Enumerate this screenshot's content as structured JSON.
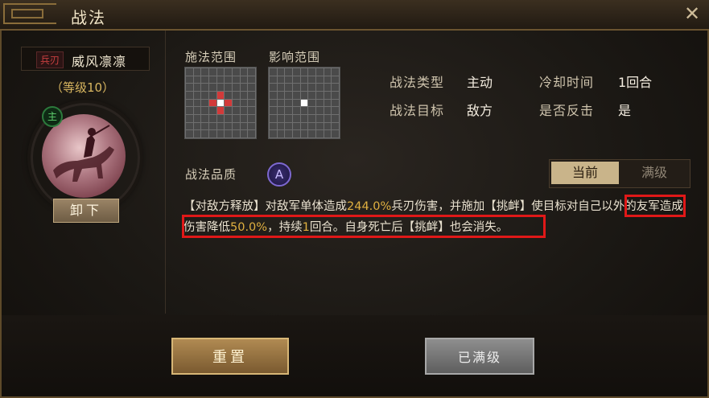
{
  "window": {
    "title": "战法",
    "close_icon": "close-icon"
  },
  "skill": {
    "type_tag": "兵刃",
    "name": "威风凛凛",
    "level": "（等级10）",
    "commander_badge": "主",
    "unequip_label": "卸下"
  },
  "ranges": {
    "cast_label": "施法范围",
    "effect_label": "影响范围"
  },
  "info": {
    "type_label": "战法类型",
    "type_value": "主动",
    "cooldown_label": "冷却时间",
    "cooldown_value": "1回合",
    "target_label": "战法目标",
    "target_value": "敌方",
    "counter_label": "是否反击",
    "counter_value": "是"
  },
  "quality": {
    "label": "战法品质",
    "grade": "A"
  },
  "tabs": {
    "current": "当前",
    "max": "满级"
  },
  "description": {
    "p1": "【对敌方释放】对敌军单体造成",
    "v1": "244.0%",
    "p2": "兵刃伤害，并施加【挑衅】",
    "p3": "使目标对自己以外的友军造成伤害降低",
    "v2": "50.0%",
    "p4": "，持续",
    "v3": "1",
    "p5": "回合。",
    "p6": "自身死亡后【挑衅】也会消失。"
  },
  "buttons": {
    "reset": "重置",
    "maxed": "已满级"
  },
  "colors": {
    "highlight": "#e0b040",
    "annotation_box": "#e01818",
    "quality_purple": "#7d68d0"
  }
}
